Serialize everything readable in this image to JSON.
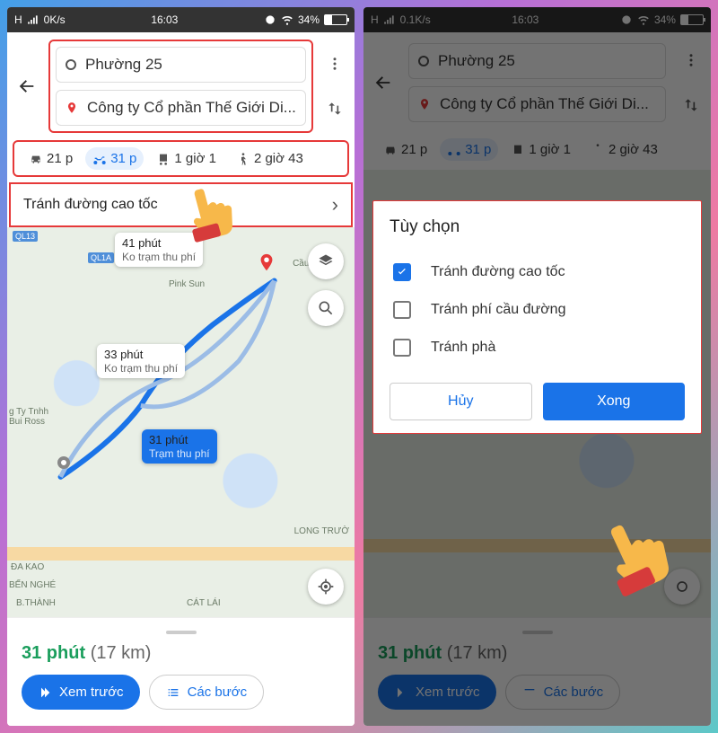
{
  "status": {
    "net": "H",
    "speed_a": "0K/s",
    "speed_b": "0.1K/s",
    "time": "16:03",
    "battery": "34%"
  },
  "route": {
    "origin": "Phường 25",
    "destination": "Công ty Cổ phần Thế Giới Di..."
  },
  "modes": {
    "car": "21 p",
    "moto": "31 p",
    "transit": "1 giờ 1",
    "walk": "2 giờ 43"
  },
  "option_row": {
    "label": "Tránh đường cao tốc"
  },
  "map": {
    "chip1": {
      "l1": "41 phút",
      "l2": "Ko trạm thu phí"
    },
    "chip2": {
      "l1": "33 phút",
      "l2": "Ko trạm thu phí"
    },
    "chip3": {
      "l1": "31 phút",
      "l2": "Trạm thu phí"
    },
    "labels": {
      "pink_sun": "Pink Sun",
      "cau_suo": "Cầu Suố",
      "bui_ross": "g Ty Tnhh\nBui Ross",
      "da_kao": "ĐA KAO",
      "ben_nghe": "BẾN NGHÉ",
      "bthanh": "B.THÀNH",
      "cat_lai": "CÁT LÁI",
      "long_truo": "LONG TRƯỜ"
    },
    "sq": {
      "ql13": "QL13",
      "ql1a": "QL1A"
    }
  },
  "summary": {
    "time": "31 phút",
    "dist": "(17 km)"
  },
  "buttons": {
    "preview": "Xem trước",
    "steps": "Các bước"
  },
  "dialog": {
    "title": "Tùy chọn",
    "opts": [
      {
        "label": "Tránh đường cao tốc",
        "checked": true
      },
      {
        "label": "Tránh phí cầu đường",
        "checked": false
      },
      {
        "label": "Tránh phà",
        "checked": false
      }
    ],
    "cancel": "Hủy",
    "done": "Xong"
  }
}
